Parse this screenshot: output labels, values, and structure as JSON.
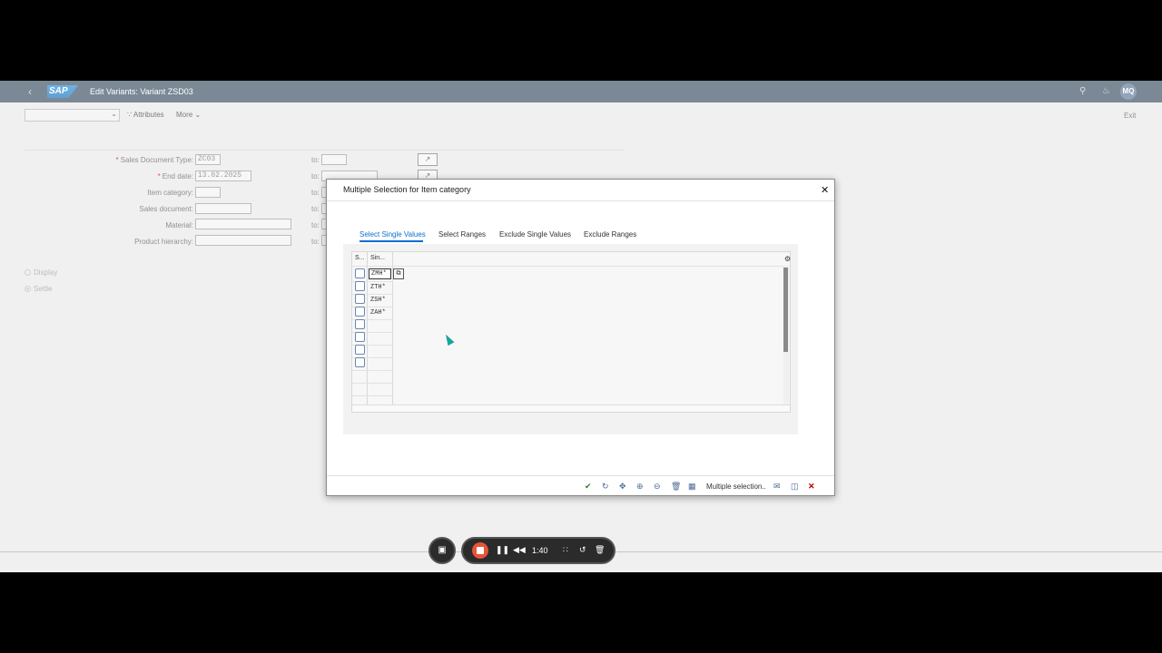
{
  "shell": {
    "title": "Edit Variants: Variant ZSD03",
    "logo": "SAP",
    "avatar": "MQ",
    "back_icon": "chevron-left-icon",
    "search_icon": "search-icon",
    "bell_icon": "bell-icon"
  },
  "toolbar": {
    "variant_value": "",
    "attributes_label": "Attributes",
    "more_label": "More",
    "exit_label": "Exit"
  },
  "form": {
    "fields": [
      {
        "label": "Sales Document Type:",
        "value": "ZC03",
        "required": true,
        "to_label": "to:",
        "to_value": ""
      },
      {
        "label": "End date:",
        "value": "13.02.2025",
        "required": true,
        "to_label": "to:",
        "to_value": ""
      },
      {
        "label": "Item category:",
        "value": "",
        "required": false,
        "to_label": "to:",
        "to_value": ""
      },
      {
        "label": "Sales document:",
        "value": "",
        "required": false,
        "to_label": "to:",
        "to_value": ""
      },
      {
        "label": "Material:",
        "value": "",
        "required": false,
        "to_label": "to:",
        "to_value": ""
      },
      {
        "label": "Product hierarchy:",
        "value": "",
        "required": false,
        "to_label": "to:",
        "to_value": ""
      }
    ],
    "radio_display": "Display",
    "radio_settle": "Settle"
  },
  "dialog": {
    "title": "Multiple Selection for Item category",
    "tabs": [
      "Select Single Values",
      "Select Ranges",
      "Exclude Single Values",
      "Exclude Ranges"
    ],
    "active_tab": 0,
    "table": {
      "col_select": "S...",
      "col_single": "Sin...",
      "editing_value": "ZMH*",
      "rows": [
        "ZTH*",
        "ZSH*",
        "ZAH*",
        "",
        "",
        "",
        ""
      ]
    },
    "footer_text": "Multiple selection.."
  },
  "recorder": {
    "time": "1:40"
  },
  "colors": {
    "shell_bg": "#354a5f",
    "accent": "#0a6ed1",
    "record": "#e8533a"
  }
}
